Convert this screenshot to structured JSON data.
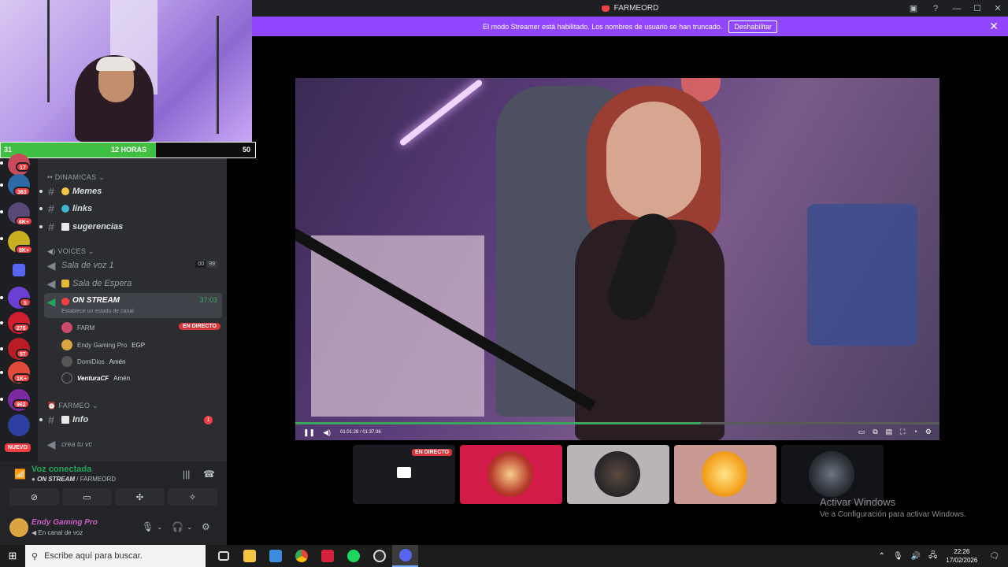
{
  "window": {
    "title": "FARMEORD",
    "controls": [
      "—",
      "☐",
      "✕"
    ]
  },
  "banner": {
    "text": "El modo Streamer está habilitado. Los nombres de usuario se han truncado.",
    "button": "Deshabilitar",
    "close": "✕"
  },
  "overlay": {
    "left_value": "31",
    "middle_text": "12 HORAS",
    "right_value": "50",
    "progress_fraction": 0.61
  },
  "servers": {
    "badges": [
      "17",
      "363",
      "6K+",
      "8K+",
      "5",
      "275",
      "57",
      "1K+",
      "962"
    ],
    "new_label": "NUEVO"
  },
  "channels": {
    "cat_dinamicas": "DINAMICAS",
    "memes": "Memes",
    "links": "links",
    "sugerencias": "sugerencias",
    "cat_voices": "VOICES",
    "sala_voz": "Sala de voz 1",
    "sala_voz_count_a": "00",
    "sala_voz_count_b": "99",
    "sala_espera": "Sala de Espera",
    "on_stream": "ON STREAM",
    "on_stream_time": "37:03",
    "on_stream_status": "Establece un estado de canal",
    "users": [
      {
        "name": "FARM",
        "live": "EN DIRECTO"
      },
      {
        "name": "Endy Gaming Pro",
        "tag": "EGP"
      },
      {
        "name": "DomiDios",
        "tag": "Amén"
      },
      {
        "name": "VenturaCF",
        "tag": "Amén"
      }
    ],
    "cat_farmeo": "FARMEO",
    "info": "Info",
    "info_unread": "1",
    "crea_vc": "crea tu vc"
  },
  "voice_panel": {
    "title": "Voz conectada",
    "channel": "ON STREAM",
    "server": "FARMEORD"
  },
  "user": {
    "name": "Endy Gaming Pro",
    "status": "En canal de voz"
  },
  "player": {
    "time": "01:01:28 / 01:37:36",
    "progress_fraction": 0.63
  },
  "thumbs": {
    "live_label": "EN DIRECTO"
  },
  "watermark": {
    "title": "Activar Windows",
    "subtitle": "Ve a Configuración para activar Windows."
  },
  "taskbar": {
    "search_placeholder": "Escribe aquí para buscar.",
    "time": "22:26",
    "date": "17/02/2026"
  }
}
